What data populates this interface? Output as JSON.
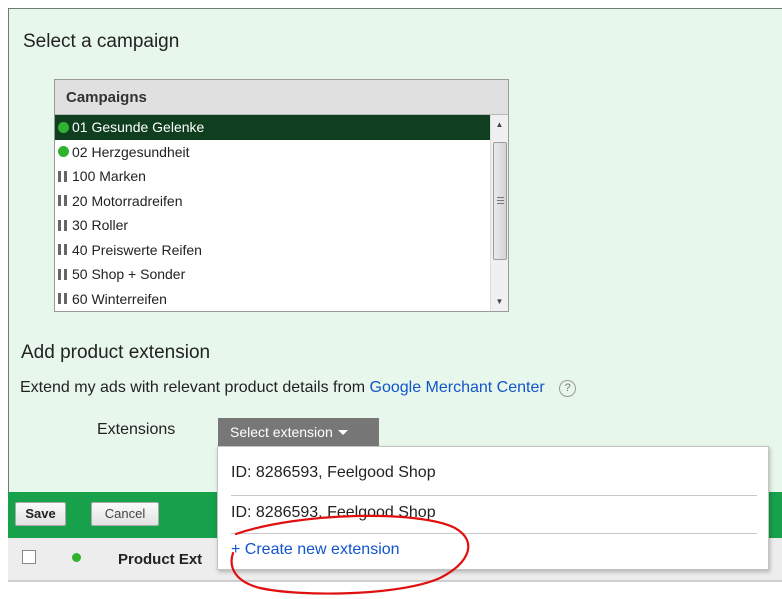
{
  "campaign_section": {
    "title": "Select a campaign",
    "list_header": "Campaigns",
    "items": [
      {
        "label": "01 Gesunde Gelenke",
        "status": "active",
        "selected": true
      },
      {
        "label": "02 Herzgesundheit",
        "status": "active",
        "selected": false
      },
      {
        "label": "100 Marken",
        "status": "paused",
        "selected": false
      },
      {
        "label": "20 Motorradreifen",
        "status": "paused",
        "selected": false
      },
      {
        "label": "30 Roller",
        "status": "paused",
        "selected": false
      },
      {
        "label": "40 Preiswerte Reifen",
        "status": "paused",
        "selected": false
      },
      {
        "label": "50 Shop + Sonder",
        "status": "paused",
        "selected": false
      },
      {
        "label": "60 Winterreifen",
        "status": "paused",
        "selected": false
      }
    ]
  },
  "extension_section": {
    "title": "Add product extension",
    "description_prefix": "Extend my ads with relevant product details from",
    "merchant_link": "Google Merchant Center",
    "help_glyph": "?",
    "extensions_label": "Extensions",
    "select_button": "Select extension"
  },
  "dropdown": {
    "options": [
      "ID: 8286593, Feelgood Shop",
      "ID: 8286593, Feelgood Shop"
    ],
    "create_label": "+ Create new extension"
  },
  "toolbar": {
    "save_label": "Save",
    "cancel_label": "Cancel"
  },
  "table": {
    "header_label": "Product Ext"
  },
  "colors": {
    "panel_bg": "#e8f7eb",
    "selected_bg": "#103f20",
    "toolbar_bg": "#17a14b",
    "link": "#1155cc",
    "status_active": "#2fb32f",
    "annotation": "#e01010"
  }
}
